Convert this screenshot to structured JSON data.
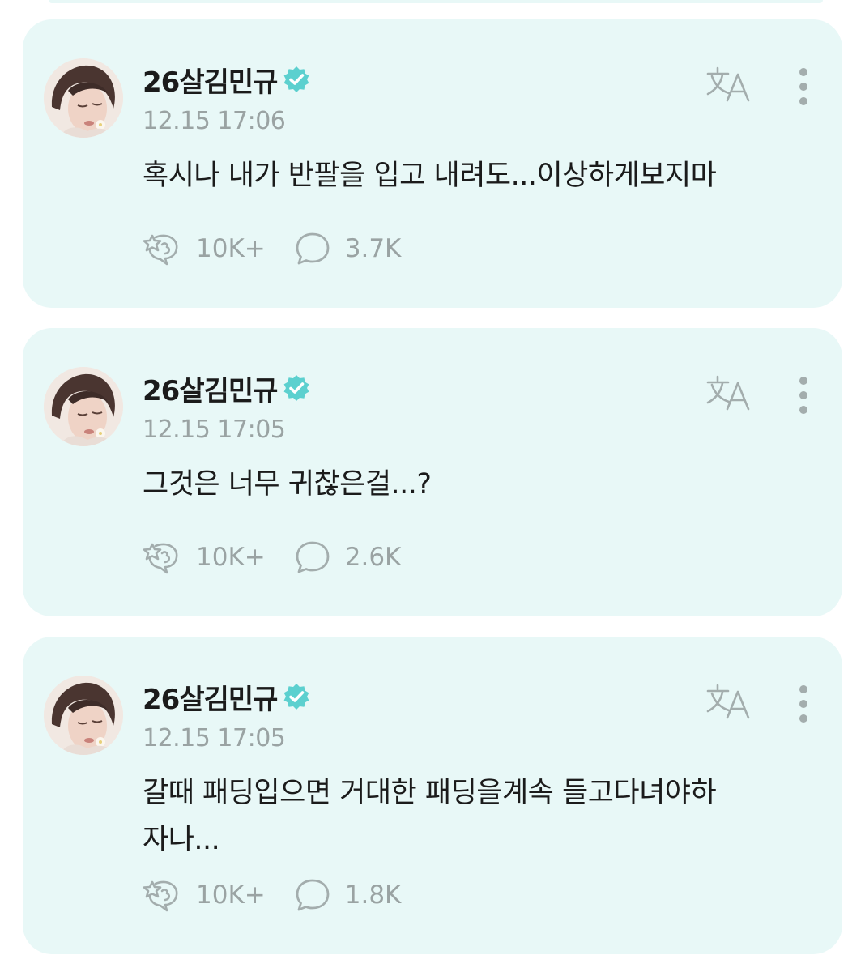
{
  "colors": {
    "card_bg": "#e8f8f7",
    "verified_badge": "#5cd0cf",
    "text_primary": "#1b1b1b",
    "text_secondary": "#9aa3a3"
  },
  "icons": {
    "verified": "verified-badge-icon",
    "translate": "translate-icon",
    "more": "more-vertical-icon",
    "reaction": "reaction-sticker-icon",
    "comment": "comment-bubble-icon"
  },
  "posts": [
    {
      "author": "26살김민규",
      "timestamp": "12.15 17:06",
      "lines": [
        "혹시나 내가 반팔을 입고 내려도...이상하게보지마"
      ],
      "likes": "10K+",
      "comments": "3.7K"
    },
    {
      "author": "26살김민규",
      "timestamp": "12.15 17:05",
      "lines": [
        "그것은 너무 귀찮은걸...?"
      ],
      "likes": "10K+",
      "comments": "2.6K"
    },
    {
      "author": "26살김민규",
      "timestamp": "12.15 17:05",
      "lines": [
        "갈때 패딩입으면 거대한 패딩을계속 들고다녀야하",
        "자나..."
      ],
      "likes": "10K+",
      "comments": "1.8K"
    }
  ]
}
